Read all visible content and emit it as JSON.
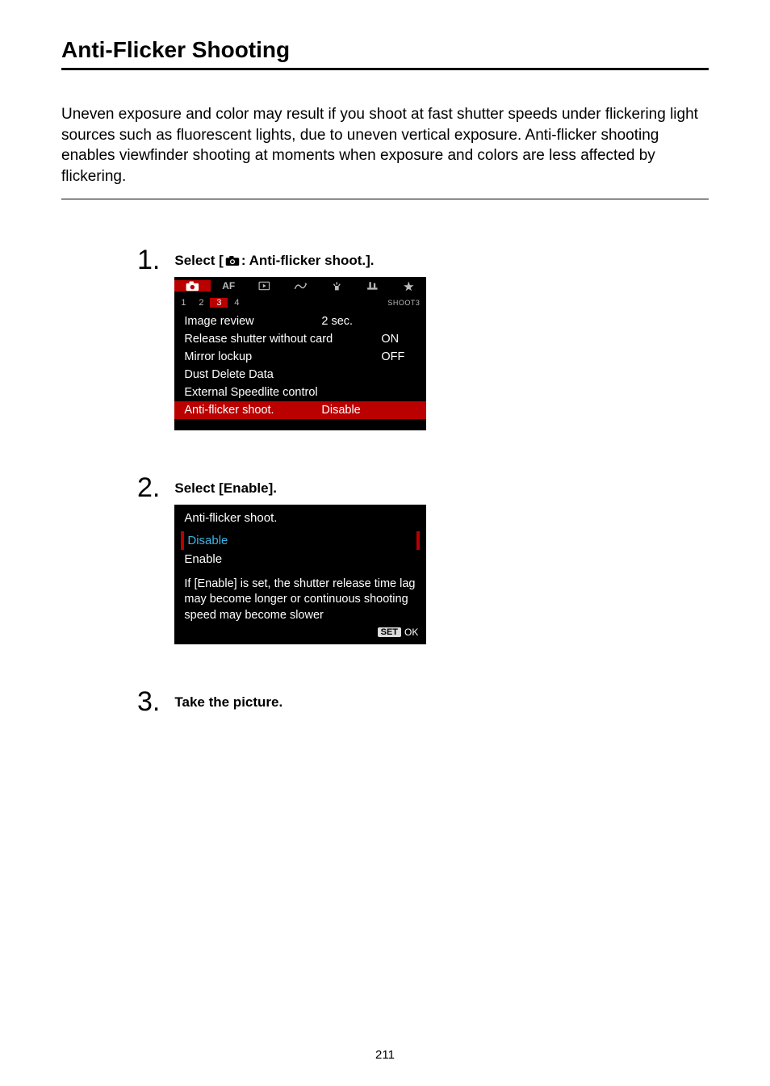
{
  "page": {
    "title": "Anti-Flicker Shooting",
    "intro": "Uneven exposure and color may result if you shoot at fast shutter speeds under flickering light sources such as fluorescent lights, due to uneven vertical exposure. Anti-flicker shooting enables viewfinder shooting at moments when exposure and colors are less affected by flickering.",
    "page_number": "211"
  },
  "steps": {
    "s1": {
      "num": "1",
      "title_before": "Select [",
      "title_after": ": Anti-flicker shoot.]."
    },
    "s2": {
      "num": "2",
      "title": "Select [Enable]."
    },
    "s3": {
      "num": "3",
      "title": "Take the picture."
    }
  },
  "screen1": {
    "top_tabs": {
      "af": "AF"
    },
    "sub_tabs": {
      "t1": "1",
      "t2": "2",
      "t3": "3",
      "t4": "4",
      "page_name": "SHOOT3"
    },
    "rows": {
      "r1": {
        "label": "Image review",
        "value": "2 sec."
      },
      "r2": {
        "label": "Release shutter without card",
        "value_right": "ON"
      },
      "r3": {
        "label": "Mirror lockup",
        "value_right": "OFF"
      },
      "r4": {
        "label": "Dust Delete Data"
      },
      "r5": {
        "label": "External Speedlite control"
      },
      "r6": {
        "label": "Anti-flicker shoot.",
        "value": "Disable"
      }
    }
  },
  "screen2": {
    "title": "Anti-flicker shoot.",
    "opt_disable": "Disable",
    "opt_enable": "Enable",
    "help": "If [Enable] is set, the shutter release time lag may become longer or continuous shooting speed may become slower",
    "set": "SET",
    "ok": "OK"
  }
}
